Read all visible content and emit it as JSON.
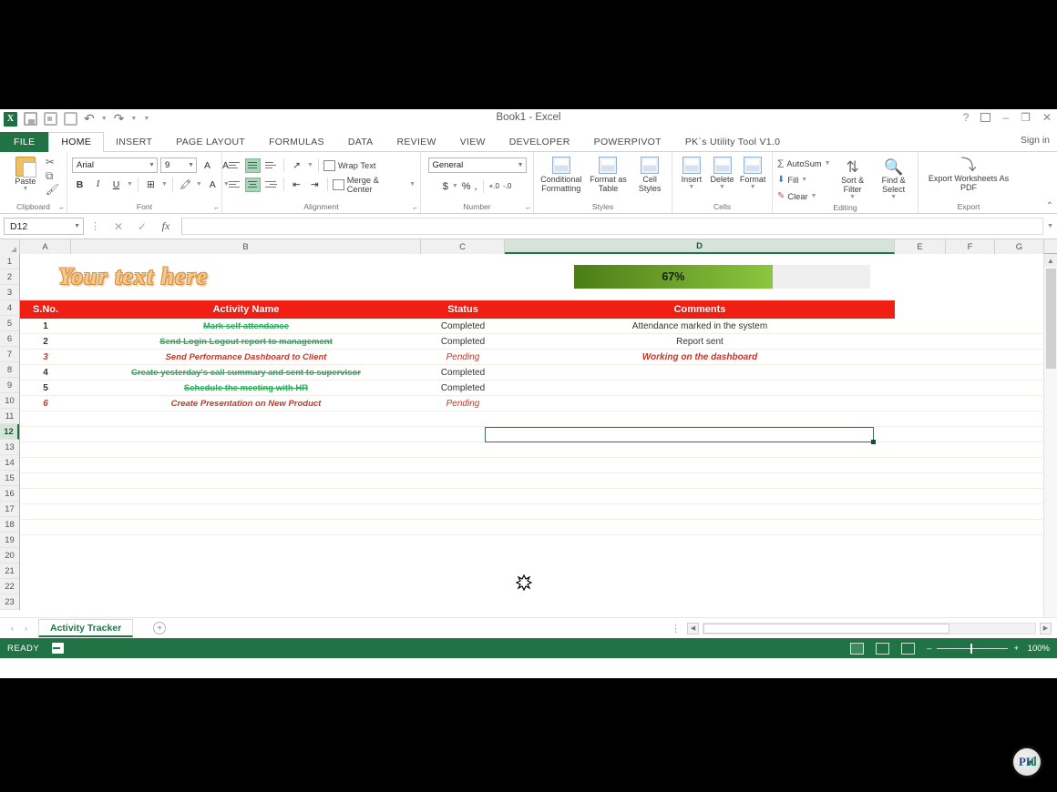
{
  "window": {
    "title": "Book1 - Excel",
    "sign_in": "Sign in",
    "help_icon": "?",
    "ribbon_display_icon": "ribbon-display-options",
    "minimize_icon": "–",
    "restore_icon": "❐",
    "close_icon": "✕"
  },
  "quick_access": {
    "app_logo": "X",
    "items": [
      "save-icon",
      "touch-mode-icon",
      "camera-icon",
      "undo-icon",
      "redo-icon",
      "customize-icon"
    ]
  },
  "ribbon": {
    "tabs": [
      {
        "label": "FILE",
        "active": false
      },
      {
        "label": "HOME",
        "active": true
      },
      {
        "label": "INSERT",
        "active": false
      },
      {
        "label": "PAGE LAYOUT",
        "active": false
      },
      {
        "label": "FORMULAS",
        "active": false
      },
      {
        "label": "DATA",
        "active": false
      },
      {
        "label": "REVIEW",
        "active": false
      },
      {
        "label": "VIEW",
        "active": false
      },
      {
        "label": "DEVELOPER",
        "active": false
      },
      {
        "label": "POWERPIVOT",
        "active": false
      },
      {
        "label": "PK`s Utility Tool V1.0",
        "active": false
      }
    ],
    "groups": {
      "clipboard": {
        "label": "Clipboard",
        "paste": "Paste",
        "cut_icon": "scissors-icon",
        "copy_icon": "copy-icon",
        "format_painter_icon": "format-painter-icon"
      },
      "font": {
        "label": "Font",
        "font_name": "Arial",
        "font_size": "9",
        "grow_font": "A",
        "shrink_font": "A",
        "bold": "B",
        "italic": "I",
        "underline": "U",
        "borders_icon": "borders-icon",
        "fill_color_icon": "fill-color-icon",
        "font_color": "A"
      },
      "alignment": {
        "label": "Alignment",
        "wrap_text": "Wrap Text",
        "merge_center": "Merge & Center",
        "orientation_icon": "orientation-icon",
        "decrease_indent_icon": "decrease-indent-icon",
        "increase_indent_icon": "increase-indent-icon"
      },
      "number": {
        "label": "Number",
        "format": "General",
        "currency": "$",
        "percent": "%",
        "comma": ",",
        "increase_decimal": "+.0",
        "decrease_decimal": "-.0"
      },
      "styles": {
        "label": "Styles",
        "conditional_formatting": "Conditional Formatting",
        "format_as_table": "Format as Table",
        "cell_styles": "Cell Styles"
      },
      "cells": {
        "label": "Cells",
        "insert": "Insert",
        "delete": "Delete",
        "format": "Format"
      },
      "editing": {
        "label": "Editing",
        "autosum": "AutoSum",
        "fill": "Fill",
        "clear": "Clear",
        "sort_filter": "Sort & Filter",
        "find_select": "Find & Select"
      },
      "export": {
        "label": "Export",
        "export_worksheets": "Export Worksheets As PDF"
      }
    },
    "collapse_icon": "collapse-ribbon-icon"
  },
  "formula_bar": {
    "name_box": "D12",
    "cancel_icon": "✕",
    "enter_icon": "✓",
    "function_icon": "fx",
    "value": "",
    "placeholder": ""
  },
  "grid": {
    "columns": [
      "A",
      "B",
      "C",
      "D",
      "E",
      "F",
      "G"
    ],
    "selected_column": "D",
    "selected_row": 12,
    "row_numbers": [
      1,
      2,
      3,
      4,
      5,
      6,
      7,
      8,
      9,
      10,
      11,
      12,
      13,
      14,
      15,
      16,
      17,
      18,
      19,
      20,
      21,
      22,
      23
    ],
    "banner_text": "Your text here",
    "progress": {
      "percent_label": "67%",
      "value": 67,
      "fill_start_color": "#4b7d17",
      "fill_end_color": "#8cc63f",
      "track_color": "#efefef"
    },
    "header_color": "#f01f13",
    "headers": {
      "sno": "S.No.",
      "activity": "Activity Name",
      "status": "Status",
      "comments": "Comments"
    },
    "rows": [
      {
        "sno": "1",
        "activity": "Mark self attendance",
        "status": "Completed",
        "comment": "Attendance marked in the system",
        "state": "done"
      },
      {
        "sno": "2",
        "activity": "Send Login Logout report to management",
        "status": "Completed",
        "comment": "Report sent",
        "state": "done"
      },
      {
        "sno": "3",
        "activity": "Send Performance Dashboard to Client",
        "status": "Pending",
        "comment": "Working on the dashboard",
        "state": "pending"
      },
      {
        "sno": "4",
        "activity": "Create yesterday's call summary and sent to supervisor",
        "status": "Completed",
        "comment": "",
        "state": "done"
      },
      {
        "sno": "5",
        "activity": "Schedule the meeting with HR",
        "status": "Completed",
        "comment": "",
        "state": "done"
      },
      {
        "sno": "6",
        "activity": "Create Presentation on New Product",
        "status": "Pending",
        "comment": "",
        "state": "pending"
      }
    ],
    "cursor_icon": "cell-select-cursor"
  },
  "sheet_tabs": {
    "prev_icon": "‹",
    "next_icon": "›",
    "active_sheet": "Activity Tracker",
    "add_sheet_icon": "+"
  },
  "status_bar": {
    "mode": "READY",
    "macro_icon": "record-macro-icon",
    "views": [
      "normal-view-icon",
      "page-layout-view-icon",
      "page-break-view-icon"
    ],
    "zoom_out": "–",
    "zoom_in": "+",
    "zoom_level": "100%"
  },
  "watermark": {
    "logo_text": "PK",
    "icon": "pk-logo-icon"
  }
}
